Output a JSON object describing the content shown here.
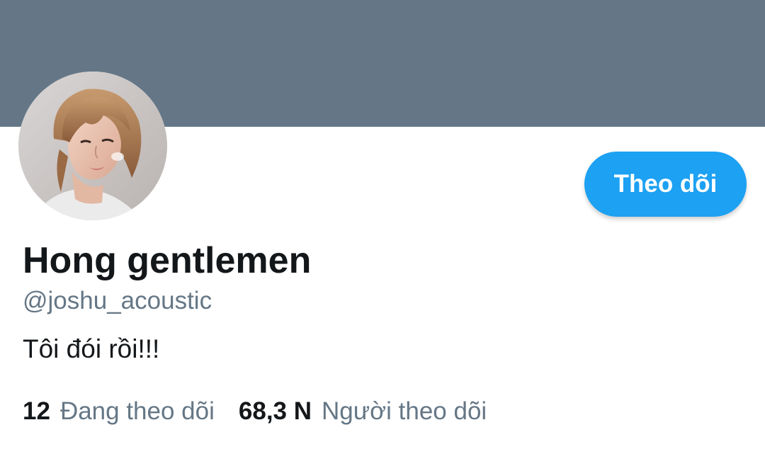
{
  "colors": {
    "banner": "#657786",
    "accent": "#1da1f2",
    "text_primary": "#14171a",
    "text_secondary": "#657786"
  },
  "profile": {
    "avatar_icon": "profile-photo",
    "follow_label": "Theo dõi",
    "display_name": "Hong gentlemen",
    "handle": "@joshu_acoustic",
    "bio": "Tôi đói rồi!!!"
  },
  "stats": {
    "following_count": "12",
    "following_label": "Đang theo dõi",
    "followers_count": "68,3 N",
    "followers_label": "Người theo dõi"
  }
}
